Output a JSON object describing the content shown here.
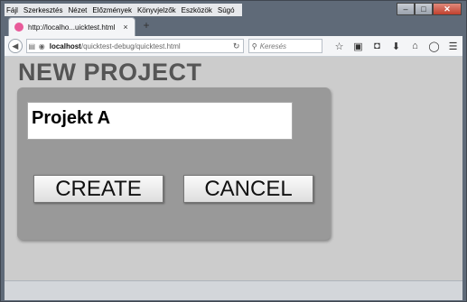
{
  "menu": {
    "items": [
      "Fájl",
      "Szerkesztés",
      "Nézet",
      "Előzmények",
      "Könyvjelzők",
      "Eszközök",
      "Súgó"
    ]
  },
  "tab": {
    "title": "http://localho...uicktest.html",
    "close_glyph": "×",
    "new_tab_glyph": "+"
  },
  "url": {
    "host": "localhost",
    "path": "/quicktest-debug/quicktest.html"
  },
  "search": {
    "placeholder": "Keresés"
  },
  "page": {
    "title": "NEW PROJECT",
    "project_name_value": "Projekt A",
    "create_label": "CREATE",
    "cancel_label": "CANCEL"
  },
  "icons": {
    "back": "back-arrow-icon",
    "favicon": "firefox-favicon-icon",
    "reader": "reader-view-icon",
    "identity": "site-identity-icon",
    "reload": "reload-icon",
    "search": "search-icon",
    "bookmark_star": "bookmark-star-icon",
    "bookmarks_list": "bookmarks-list-icon",
    "pocket": "pocket-icon",
    "downloads": "download-icon",
    "home": "home-icon",
    "hello": "chat-bubble-icon",
    "menu": "hamburger-menu-icon"
  },
  "colors": {
    "page_background": "#cccccc",
    "panel_background": "#999999",
    "title_color": "#555555",
    "chrome_background": "#5f6a78"
  }
}
